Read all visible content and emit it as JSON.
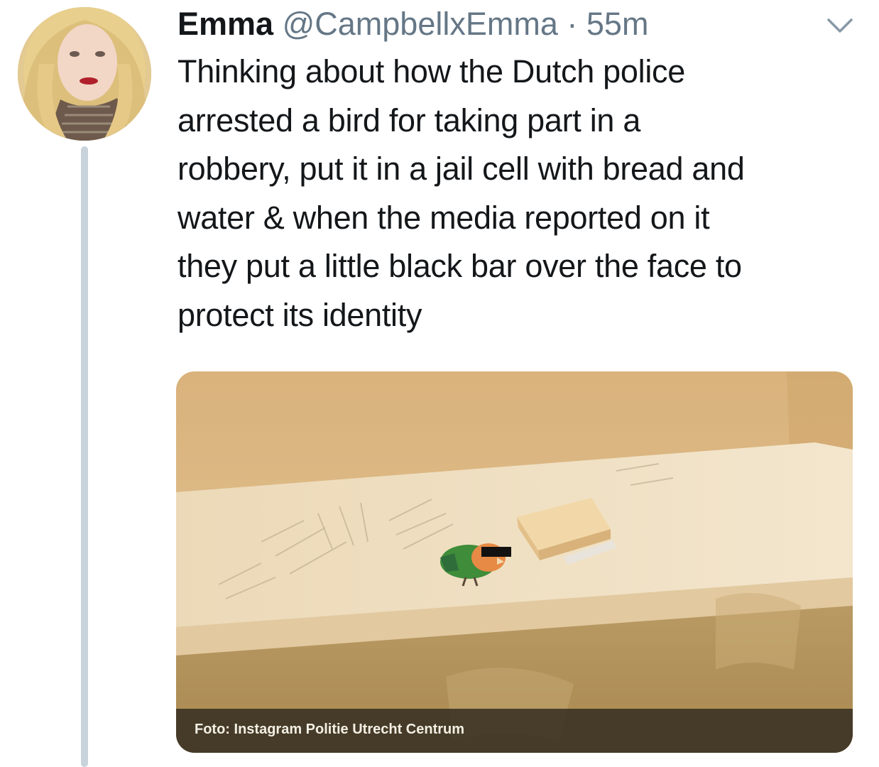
{
  "tweet": {
    "author_name": "Emma",
    "handle": "@CampbellxEmma",
    "separator": "·",
    "time": "55m",
    "text": "Thinking about how the Dutch police\narrested a bird for taking part in a\nrobbery, put it in a jail cell with bread and\nwater & when the media reported on it\nthey put a little black bar over the face to\nprotect its identity",
    "more_icon": "chevron-down-icon",
    "media": {
      "caption": "Foto: Instagram Politie Utrecht Centrum",
      "depicts": "bird-photo"
    }
  },
  "colors": {
    "text_primary": "#14171a",
    "text_secondary": "#657786",
    "thread_line": "#c9d3dc",
    "caption_bar": "#373022"
  }
}
